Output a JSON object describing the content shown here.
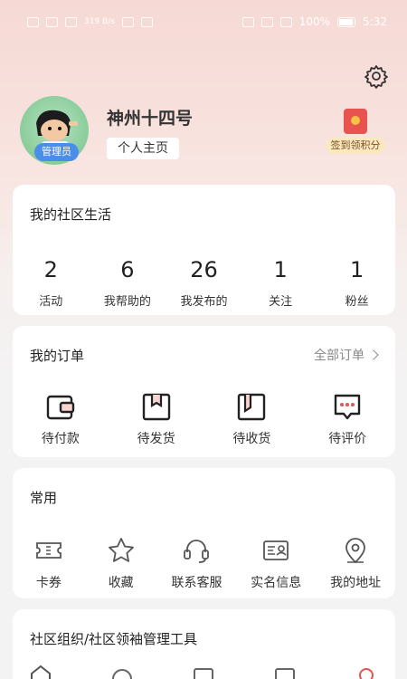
{
  "status_bar": {
    "speed": "319 B/s",
    "battery": "100%",
    "time": "5:32"
  },
  "profile": {
    "nickname": "神州十四号",
    "homepage_button": "个人主页",
    "admin_badge": "管理员",
    "checkin_label": "签到领积分"
  },
  "community": {
    "title": "我的社区生活",
    "stats": [
      {
        "value": "2",
        "label": "活动"
      },
      {
        "value": "6",
        "label": "我帮助的"
      },
      {
        "value": "26",
        "label": "我发布的"
      },
      {
        "value": "1",
        "label": "关注"
      },
      {
        "value": "1",
        "label": "粉丝"
      }
    ]
  },
  "orders": {
    "title": "我的订单",
    "all_orders": "全部订单",
    "items": [
      {
        "label": "待付款",
        "icon": "wallet-icon"
      },
      {
        "label": "待发货",
        "icon": "package-icon"
      },
      {
        "label": "待收货",
        "icon": "box-receive-icon"
      },
      {
        "label": "待评价",
        "icon": "comment-icon"
      }
    ]
  },
  "common": {
    "title": "常用",
    "items": [
      {
        "label": "卡券",
        "icon": "coupon-icon"
      },
      {
        "label": "收藏",
        "icon": "star-icon"
      },
      {
        "label": "联系客服",
        "icon": "headset-icon"
      },
      {
        "label": "实名信息",
        "icon": "id-card-icon"
      },
      {
        "label": "我的地址",
        "icon": "location-pin-icon"
      }
    ]
  },
  "tools": {
    "title": "社区组织/社区领袖管理工具"
  },
  "colors": {
    "accent": "#e8534f",
    "badge": "#4b8ee8",
    "background_top": "#f6d9d4"
  }
}
